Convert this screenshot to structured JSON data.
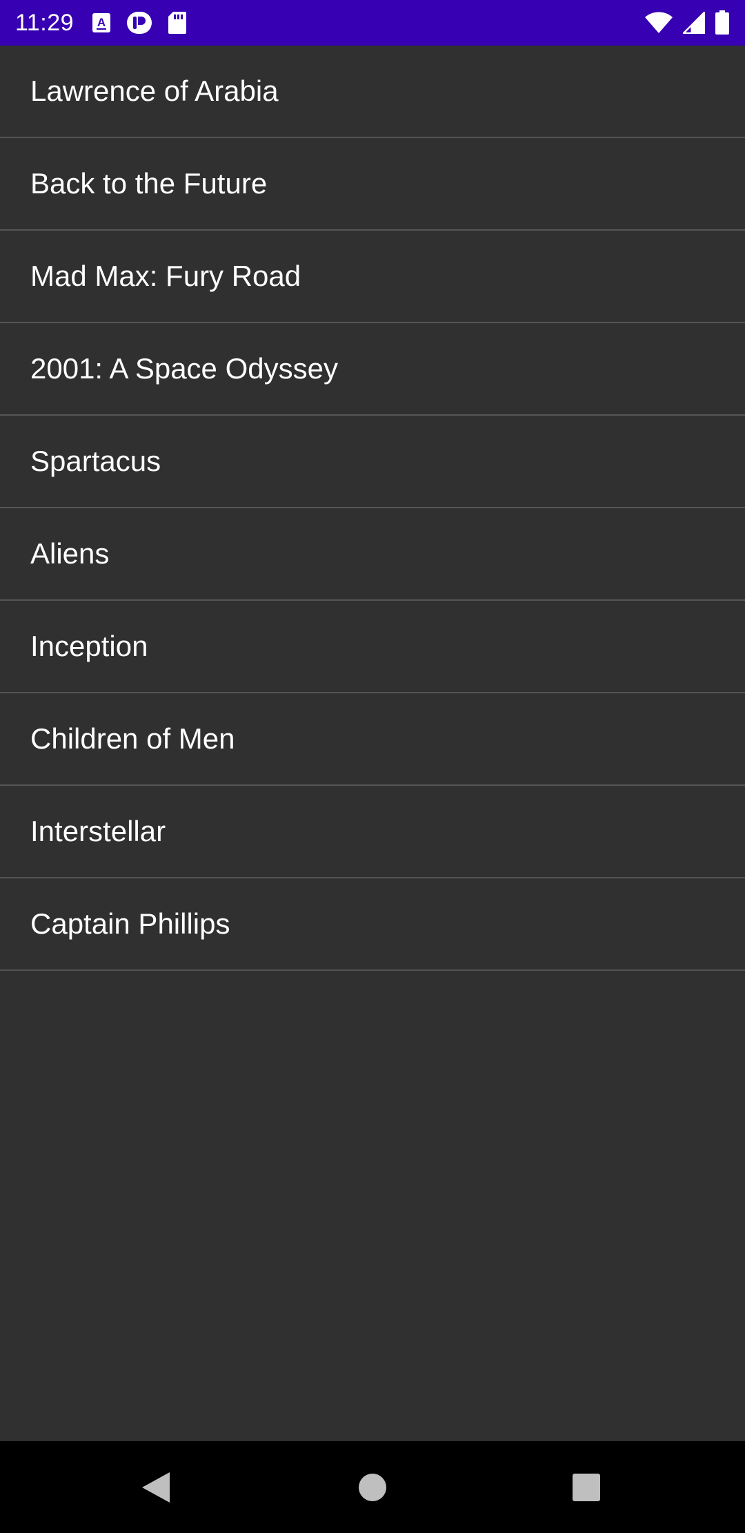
{
  "status_bar": {
    "time": "11:29",
    "color": "#3700b3",
    "notification_icons": [
      "text-a-icon",
      "p-app-icon",
      "sd-card-icon"
    ],
    "system_icons": [
      "wifi-icon",
      "cellular-signal-icon",
      "battery-icon"
    ]
  },
  "movies": [
    {
      "title": "Lawrence of Arabia"
    },
    {
      "title": "Back to the Future"
    },
    {
      "title": "Mad Max: Fury Road"
    },
    {
      "title": "2001: A Space Odyssey"
    },
    {
      "title": "Spartacus"
    },
    {
      "title": "Aliens"
    },
    {
      "title": "Inception"
    },
    {
      "title": "Children of Men"
    },
    {
      "title": "Interstellar"
    },
    {
      "title": "Captain Phillips"
    }
  ],
  "theme": {
    "background": "#303030",
    "divider": "#555555",
    "text": "#ffffff",
    "nav_background": "#000000"
  },
  "navigation": {
    "buttons": [
      "back-icon",
      "home-icon",
      "recents-icon"
    ]
  }
}
